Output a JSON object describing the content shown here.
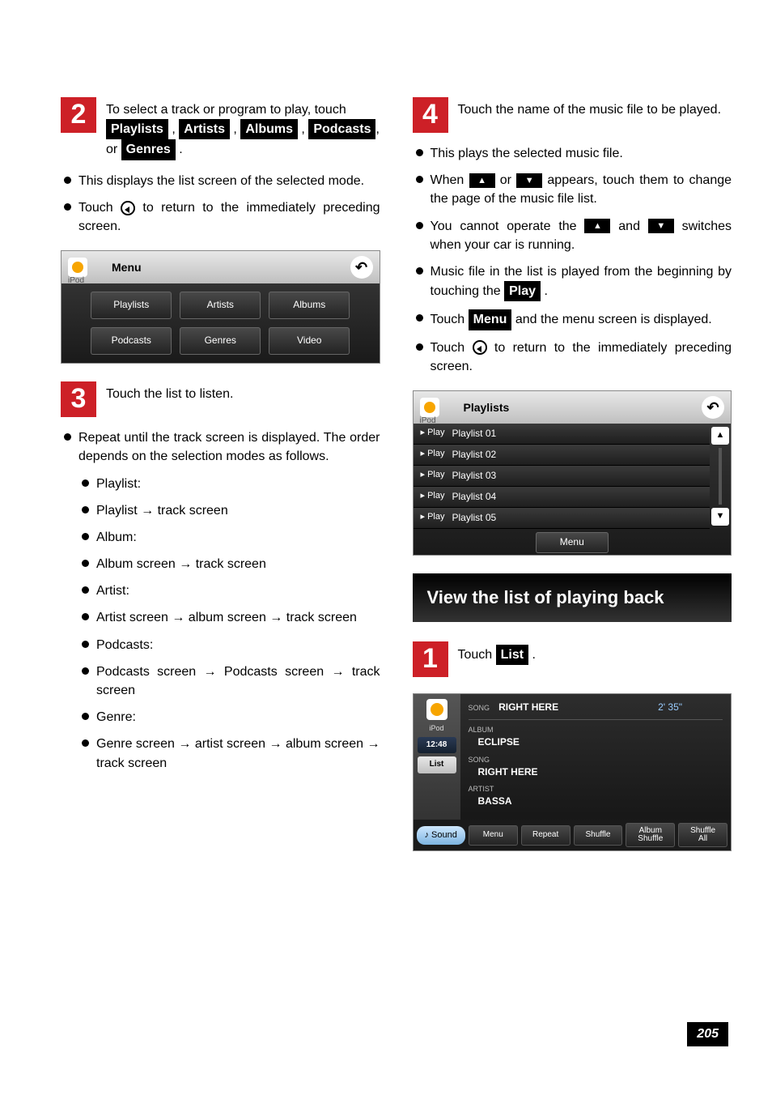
{
  "left": {
    "step2": {
      "num": "2",
      "text_before": "To select a track or program to play, touch ",
      "btn_playlists": "Playlists",
      "btn_artists": "Artists",
      "btn_albums": "Albums",
      "btn_podcasts": "Podcasts",
      "btn_genres": "Genres",
      "sep1": " , ",
      "sep2": " , ",
      "sep3": " , ",
      "sep4": ", or ",
      "end": " ."
    },
    "b1": "This displays the list screen of the selected mode.",
    "b2a": "Touch ",
    "b2b": " to return to the immediately preceding screen.",
    "shot1": {
      "title": "Menu",
      "ipod": "iPod",
      "buttons": [
        "Playlists",
        "Artists",
        "Albums",
        "Podcasts",
        "Genres",
        "Video"
      ]
    },
    "step3": {
      "num": "3",
      "text": "Touch the list to listen."
    },
    "b3": "Repeat until the track screen is displayed. The order depends on the selection modes as follows.",
    "modes": [
      "Playlist:",
      "Playlist → track screen",
      "Album:",
      "Album screen → track screen",
      "Artist:",
      "Artist screen → album screen → track screen",
      "Podcasts:",
      "Podcasts screen → Podcasts screen → track screen",
      "Genre:",
      "Genre screen → artist screen → album screen → track screen"
    ]
  },
  "right": {
    "step4": {
      "num": "4",
      "text": "Touch the name of the music file to be played."
    },
    "b1": "This plays the selected music file.",
    "b2a": "When ",
    "b2b": " or ",
    "b2c": " appears, touch them to change the page of the music file list.",
    "b3a": "You cannot operate the ",
    "b3b": " and ",
    "b3c": " switches when your car is running.",
    "b4a": "Music file in the list is played from the beginning by touching the ",
    "b4_play": "Play",
    "b4b": " .",
    "b5a": "Touch ",
    "b5_menu": "Menu",
    "b5b": " and the menu screen is displayed.",
    "b6a": "Touch ",
    "b6b": " to return to the immediately preceding screen.",
    "shot2": {
      "title": "Playlists",
      "ipod": "iPod",
      "play": "Play",
      "rows": [
        "Playlist 01",
        "Playlist 02",
        "Playlist 03",
        "Playlist 04",
        "Playlist 05"
      ],
      "menu": "Menu"
    },
    "section": "View the list of playing back",
    "step1": {
      "num": "1",
      "text_a": "Touch ",
      "btn": "List",
      "text_b": " ."
    },
    "shot3": {
      "ipod": "iPod",
      "time_chip": "12:48",
      "list_chip": "List",
      "song_lbl": "SONG",
      "song_val": "RIGHT HERE",
      "duration": "2' 35\"",
      "album_lbl": "ALBUM",
      "album_val": "ECLIPSE",
      "song2_lbl": "SONG",
      "song2_val": "RIGHT HERE",
      "artist_lbl": "ARTIST",
      "artist_val": "BASSA",
      "sound": "♪ Sound",
      "bottom": [
        "Menu",
        "Repeat",
        "Shuffle",
        "Album\nShuffle",
        "Shuffle\nAll"
      ]
    }
  },
  "page_number": "205"
}
